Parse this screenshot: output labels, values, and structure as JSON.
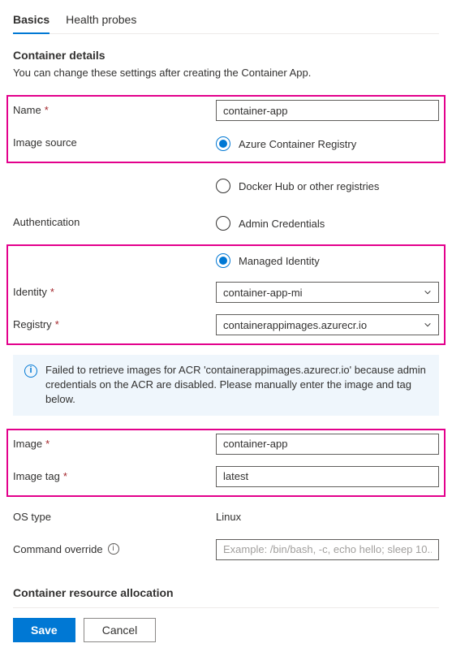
{
  "tabs": {
    "basics": "Basics",
    "health": "Health probes"
  },
  "section": {
    "title": "Container details",
    "desc": "You can change these settings after creating the Container App."
  },
  "labels": {
    "name": "Name",
    "imageSource": "Image source",
    "authentication": "Authentication",
    "identity": "Identity",
    "registry": "Registry",
    "image": "Image",
    "imageTag": "Image tag",
    "osType": "OS type",
    "commandOverride": "Command override"
  },
  "fields": {
    "name": "container-app",
    "identity": "container-app-mi",
    "registry": "containerappimages.azurecr.io",
    "image": "container-app",
    "imageTag": "latest",
    "osType": "Linux",
    "commandOverridePlaceholder": "Example: /bin/bash, -c, echo hello; sleep 10..."
  },
  "radios": {
    "acr": "Azure Container Registry",
    "docker": "Docker Hub or other registries",
    "adminCreds": "Admin Credentials",
    "managedId": "Managed Identity"
  },
  "banner": "Failed to retrieve images for ACR 'containerappimages.azurecr.io' because admin credentials on the ACR are disabled. Please manually enter the image and tag below.",
  "resourceSection": "Container resource allocation",
  "buttons": {
    "save": "Save",
    "cancel": "Cancel"
  }
}
